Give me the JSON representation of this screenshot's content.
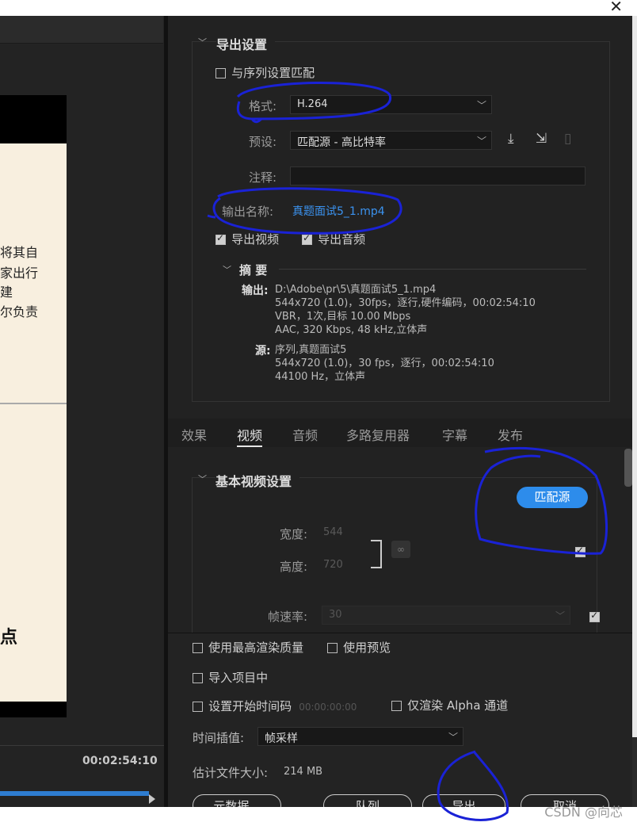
{
  "left": {
    "doc_lines": [
      "将其自",
      "家出行",
      "建",
      "尔负责"
    ],
    "doc_big": "点",
    "timecode": "00:02:54:10"
  },
  "export": {
    "section_title": "导出设置",
    "match_sequence": "与序列设置匹配",
    "format_label": "格式:",
    "format_value": "H.264",
    "preset_label": "预设:",
    "preset_value": "匹配源 - 高比特率",
    "comments_label": "注释:",
    "comments_value": "",
    "output_name_label": "输出名称:",
    "output_name_value": "真题面试5_1.mp4",
    "export_video": "导出视频",
    "export_audio": "导出音频"
  },
  "summary": {
    "title": "摘 要",
    "output_label": "输出:",
    "output_lines": [
      "D:\\Adobe\\pr\\5\\真题面试5_1.mp4",
      "544x720 (1.0)，30fps，逐行,硬件编码，00:02:54:10",
      "VBR，1次,目标 10.00 Mbps",
      "AAC, 320 Kbps, 48  kHz,立体声"
    ],
    "source_label": "源:",
    "source_lines": [
      "序列,真题面试5",
      "544x720 (1.0)，30 fps，逐行，00:02:54:10",
      "44100 Hz，立体声"
    ]
  },
  "tabs": [
    "效果",
    "视频",
    "音频",
    "多路复用器",
    "字幕",
    "发布"
  ],
  "video": {
    "section_title": "基本视频设置",
    "match_source": "匹配源",
    "width_label": "宽度:",
    "width_value": "544",
    "height_label": "高度:",
    "height_value": "720",
    "fps_label": "帧速率:",
    "fps_value": "30"
  },
  "bottom": {
    "max_render": "使用最高渲染质量",
    "use_preview": "使用预览",
    "import_project": "导入项目中",
    "set_start_tc": "设置开始时间码",
    "start_tc_value": "00:00:00:00",
    "alpha_only": "仅渲染 Alpha 通道",
    "interp_label": "时间插值:",
    "interp_value": "帧采样",
    "filesize_label": "估计文件大小:",
    "filesize_value": "214 MB",
    "btn_metadata": "元数据...",
    "btn_queue": "队列",
    "btn_export": "导出",
    "btn_cancel": "取消"
  },
  "watermark": "CSDN @向芯",
  "colors": {
    "accent": "#2d8ceb",
    "annotation": "#1a22d6",
    "panel": "#222222"
  }
}
